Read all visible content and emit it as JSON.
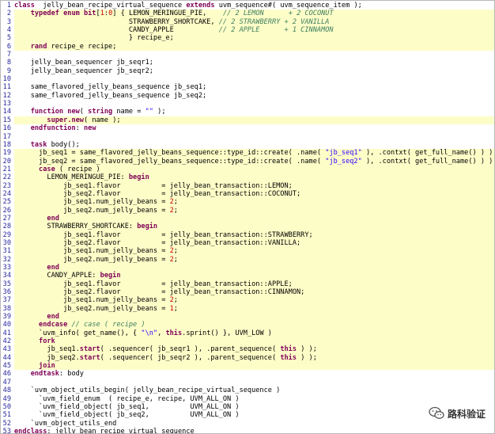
{
  "colors": {
    "highlight": "#fdfdc8",
    "keyword": "#7f0055",
    "comment": "#3f7f5f",
    "string": "#2a00ff",
    "number": "#cc0000",
    "gutter": "#2a2aa0"
  },
  "lines": [
    {
      "n": "1",
      "hl": false,
      "segs": [
        [
          "kw",
          "class"
        ],
        [
          "",
          "  jelly_bean_recipe_virtual_sequence "
        ],
        [
          "kw",
          "extends"
        ],
        [
          "",
          " uvm_sequence#( uvm_sequence_item );"
        ]
      ]
    },
    {
      "n": "2",
      "hl": true,
      "segs": [
        [
          "",
          "    "
        ],
        [
          "kw",
          "typedef enum bit"
        ],
        [
          "",
          "["
        ],
        [
          "nm",
          "1"
        ],
        [
          "",
          ":"
        ],
        [
          "nm",
          "0"
        ],
        [
          "",
          "] { LEMON_MERINGUE_PIE,    "
        ],
        [
          "cm",
          "// 2 LEMON      + 2 COCONUT"
        ]
      ]
    },
    {
      "n": "3",
      "hl": true,
      "segs": [
        [
          "",
          "                            STRAWBERRY_SHORTCAKE, "
        ],
        [
          "cm",
          "// 2 STRAWBERRY + 2 VANILLA"
        ]
      ]
    },
    {
      "n": "4",
      "hl": true,
      "segs": [
        [
          "",
          "                            CANDY_APPLE           "
        ],
        [
          "cm",
          "// 2 APPLE      + 1 CINNAMON"
        ]
      ]
    },
    {
      "n": "5",
      "hl": true,
      "segs": [
        [
          "",
          "                            } recipe_e;"
        ]
      ]
    },
    {
      "n": "6",
      "hl": true,
      "segs": [
        [
          "",
          "    "
        ],
        [
          "kw",
          "rand"
        ],
        [
          "",
          " recipe_e recipe;"
        ]
      ]
    },
    {
      "n": "7",
      "hl": false,
      "segs": [
        [
          "",
          ""
        ]
      ]
    },
    {
      "n": "8",
      "hl": false,
      "segs": [
        [
          "",
          "    jelly_bean_sequencer jb_seqr1;"
        ]
      ]
    },
    {
      "n": "9",
      "hl": false,
      "segs": [
        [
          "",
          "    jelly_bean_sequencer jb_seqr2;"
        ]
      ]
    },
    {
      "n": "10",
      "hl": false,
      "segs": [
        [
          "",
          ""
        ]
      ]
    },
    {
      "n": "11",
      "hl": false,
      "segs": [
        [
          "",
          "    same_flavored_jelly_beans_sequence jb_seq1;"
        ]
      ]
    },
    {
      "n": "12",
      "hl": false,
      "segs": [
        [
          "",
          "    same_flavored_jelly_beans_sequence jb_seq2;"
        ]
      ]
    },
    {
      "n": "13",
      "hl": false,
      "segs": [
        [
          "",
          ""
        ]
      ]
    },
    {
      "n": "14",
      "hl": false,
      "segs": [
        [
          "",
          "    "
        ],
        [
          "kw",
          "function new"
        ],
        [
          "",
          "( "
        ],
        [
          "kw",
          "string"
        ],
        [
          "",
          " name = "
        ],
        [
          "st",
          "\"\""
        ],
        [
          "",
          " );"
        ]
      ]
    },
    {
      "n": "15",
      "hl": true,
      "segs": [
        [
          "",
          "        "
        ],
        [
          "kw",
          "super.new"
        ],
        [
          "",
          "( name );"
        ]
      ]
    },
    {
      "n": "16",
      "hl": false,
      "segs": [
        [
          "",
          "    "
        ],
        [
          "kw",
          "endfunction"
        ],
        [
          "",
          ": "
        ],
        [
          "kw",
          "new"
        ]
      ]
    },
    {
      "n": "17",
      "hl": false,
      "segs": [
        [
          "",
          ""
        ]
      ]
    },
    {
      "n": "18",
      "hl": false,
      "segs": [
        [
          "",
          "    "
        ],
        [
          "kw",
          "task"
        ],
        [
          "",
          " body();"
        ]
      ]
    },
    {
      "n": "19",
      "hl": true,
      "segs": [
        [
          "",
          "      jb_seq1 = same_flavored_jelly_beans_sequence::type_id::create( .name( "
        ],
        [
          "st",
          "\"jb_seq1\""
        ],
        [
          "",
          " ), .contxt( get_full_name() ) );"
        ]
      ]
    },
    {
      "n": "20",
      "hl": true,
      "segs": [
        [
          "",
          "      jb_seq2 = same_flavored_jelly_beans_sequence::type_id::create( .name( "
        ],
        [
          "st",
          "\"jb_seq2\""
        ],
        [
          "",
          " ), .contxt( get_full_name() ) );"
        ]
      ]
    },
    {
      "n": "21",
      "hl": true,
      "segs": [
        [
          "",
          "      "
        ],
        [
          "kw",
          "case"
        ],
        [
          "",
          " ( recipe )"
        ]
      ]
    },
    {
      "n": "22",
      "hl": true,
      "segs": [
        [
          "",
          "        LEMON_MERINGUE_PIE: "
        ],
        [
          "kw",
          "begin"
        ]
      ]
    },
    {
      "n": "23",
      "hl": true,
      "segs": [
        [
          "",
          "            jb_seq1.flavor          = jelly_bean_transaction::LEMON;"
        ]
      ]
    },
    {
      "n": "24",
      "hl": true,
      "segs": [
        [
          "",
          "            jb_seq2.flavor          = jelly_bean_transaction::COCONUT;"
        ]
      ]
    },
    {
      "n": "25",
      "hl": true,
      "segs": [
        [
          "",
          "            jb_seq1.num_jelly_beans = "
        ],
        [
          "nm",
          "2"
        ],
        [
          "",
          ";"
        ]
      ]
    },
    {
      "n": "26",
      "hl": true,
      "segs": [
        [
          "",
          "            jb_seq2.num_jelly_beans = "
        ],
        [
          "nm",
          "2"
        ],
        [
          "",
          ";"
        ]
      ]
    },
    {
      "n": "27",
      "hl": true,
      "segs": [
        [
          "",
          "        "
        ],
        [
          "kw",
          "end"
        ]
      ]
    },
    {
      "n": "28",
      "hl": true,
      "segs": [
        [
          "",
          "        STRAWBERRY_SHORTCAKE: "
        ],
        [
          "kw",
          "begin"
        ]
      ]
    },
    {
      "n": "29",
      "hl": true,
      "segs": [
        [
          "",
          "            jb_seq1.flavor          = jelly_bean_transaction::STRAWBERRY;"
        ]
      ]
    },
    {
      "n": "30",
      "hl": true,
      "segs": [
        [
          "",
          "            jb_seq2.flavor          = jelly_bean_transaction::VANILLA;"
        ]
      ]
    },
    {
      "n": "31",
      "hl": true,
      "segs": [
        [
          "",
          "            jb_seq1.num_jelly_beans = "
        ],
        [
          "nm",
          "2"
        ],
        [
          "",
          ";"
        ]
      ]
    },
    {
      "n": "32",
      "hl": true,
      "segs": [
        [
          "",
          "            jb_seq2.num_jelly_beans = "
        ],
        [
          "nm",
          "2"
        ],
        [
          "",
          ";"
        ]
      ]
    },
    {
      "n": "33",
      "hl": true,
      "segs": [
        [
          "",
          "        "
        ],
        [
          "kw",
          "end"
        ]
      ]
    },
    {
      "n": "34",
      "hl": true,
      "segs": [
        [
          "",
          "        CANDY_APPLE: "
        ],
        [
          "kw",
          "begin"
        ]
      ]
    },
    {
      "n": "35",
      "hl": true,
      "segs": [
        [
          "",
          "            jb_seq1.flavor          = jelly_bean_transaction::APPLE;"
        ]
      ]
    },
    {
      "n": "36",
      "hl": true,
      "segs": [
        [
          "",
          "            jb_seq2.flavor          = jelly_bean_transaction::CINNAMON;"
        ]
      ]
    },
    {
      "n": "37",
      "hl": true,
      "segs": [
        [
          "",
          "            jb_seq1.num_jelly_beans = "
        ],
        [
          "nm",
          "2"
        ],
        [
          "",
          ";"
        ]
      ]
    },
    {
      "n": "38",
      "hl": true,
      "segs": [
        [
          "",
          "            jb_seq2.num_jelly_beans = "
        ],
        [
          "nm",
          "1"
        ],
        [
          "",
          ";"
        ]
      ]
    },
    {
      "n": "39",
      "hl": true,
      "segs": [
        [
          "",
          "        "
        ],
        [
          "kw",
          "end"
        ]
      ]
    },
    {
      "n": "40",
      "hl": true,
      "segs": [
        [
          "",
          "      "
        ],
        [
          "kw",
          "endcase"
        ],
        [
          "",
          " "
        ],
        [
          "cm",
          "// case ( recipe )"
        ]
      ]
    },
    {
      "n": "41",
      "hl": true,
      "segs": [
        [
          "",
          "      `uvm_info( get_name(), { "
        ],
        [
          "st",
          "\"\\n\""
        ],
        [
          "",
          ", "
        ],
        [
          "kw",
          "this"
        ],
        [
          "",
          ".sprint() }, UVM_LOW )"
        ]
      ]
    },
    {
      "n": "42",
      "hl": true,
      "segs": [
        [
          "",
          "      "
        ],
        [
          "kw",
          "fork"
        ]
      ]
    },
    {
      "n": "43",
      "hl": true,
      "segs": [
        [
          "",
          "        jb_seq1."
        ],
        [
          "kw",
          "start"
        ],
        [
          "",
          "( .sequencer( jb_seqr1 ), .parent_sequence( "
        ],
        [
          "kw",
          "this"
        ],
        [
          "",
          " ) );"
        ]
      ]
    },
    {
      "n": "44",
      "hl": true,
      "segs": [
        [
          "",
          "        jb_seq2."
        ],
        [
          "kw",
          "start"
        ],
        [
          "",
          "( .sequencer( jb_seqr2 ), .parent_sequence( "
        ],
        [
          "kw",
          "this"
        ],
        [
          "",
          " ) );"
        ]
      ]
    },
    {
      "n": "45",
      "hl": true,
      "segs": [
        [
          "",
          "      "
        ],
        [
          "kw",
          "join"
        ]
      ]
    },
    {
      "n": "46",
      "hl": false,
      "segs": [
        [
          "",
          "    "
        ],
        [
          "kw",
          "endtask"
        ],
        [
          "",
          ": body"
        ]
      ]
    },
    {
      "n": "47",
      "hl": false,
      "segs": [
        [
          "",
          ""
        ]
      ]
    },
    {
      "n": "48",
      "hl": false,
      "segs": [
        [
          "",
          "    `uvm_object_utils_begin( jelly_bean_recipe_virtual_sequence )"
        ]
      ]
    },
    {
      "n": "49",
      "hl": false,
      "segs": [
        [
          "",
          "      `uvm_field_enum  ( recipe_e, recipe, UVM_ALL_ON )"
        ]
      ]
    },
    {
      "n": "50",
      "hl": false,
      "segs": [
        [
          "",
          "      `uvm_field_object( jb_seq1,          UVM_ALL_ON )"
        ]
      ]
    },
    {
      "n": "51",
      "hl": false,
      "segs": [
        [
          "",
          "      `uvm_field_object( jb_seq2,          UVM_ALL_ON )"
        ]
      ]
    },
    {
      "n": "52",
      "hl": false,
      "segs": [
        [
          "",
          "    `uvm_object_utils_end"
        ]
      ]
    },
    {
      "n": "53",
      "hl": false,
      "segs": [
        [
          "kw",
          "endclass"
        ],
        [
          "",
          ": jelly_bean_recipe_virtual_sequence"
        ]
      ]
    }
  ],
  "watermark": {
    "text": "路科验证",
    "icon": "wechat-icon"
  }
}
